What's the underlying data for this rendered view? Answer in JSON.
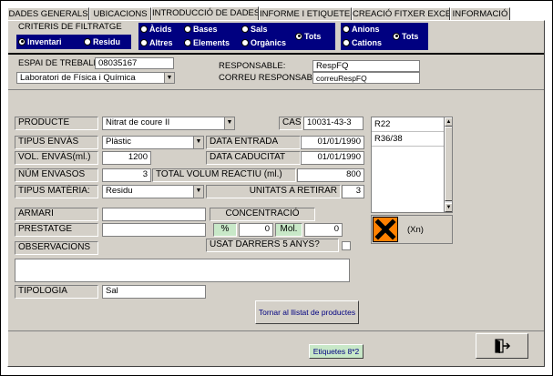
{
  "tabs": [
    {
      "label": "DADES GENERALS"
    },
    {
      "label": "UBICACIONS"
    },
    {
      "label": "INTRODUCCIÓ DE DADES"
    },
    {
      "label": "INFORME I ETIQUETES"
    },
    {
      "label": "CREACIÓ FITXER EXCEL"
    },
    {
      "label": "INFORMACIÓ"
    }
  ],
  "filter": {
    "title": "CRITERIS DE FILTRATGE",
    "inventari": "Inventari",
    "residu": "Residu",
    "acids": "Àcids",
    "bases": "Bases",
    "sals": "Sals",
    "altres": "Altres",
    "elements": "Elements",
    "organics": "Orgànics",
    "tots": "Tots",
    "anions": "Anions",
    "cations": "Cations",
    "tots2": "Tots"
  },
  "workspace": {
    "espai_label": "ESPAI DE TREBALL:",
    "espai_value": "08035167",
    "lab_value": "Laboratori de Física i Química",
    "responsable_label": "RESPONSABLE:",
    "responsable_value": "RespFQ",
    "correu_label": "CORREU RESPONSABLE:",
    "correu_value": "correuRespFQ"
  },
  "form": {
    "producte_label": "PRODUCTE",
    "producte_value": "Nitrat de coure II",
    "cas_label": "CAS",
    "cas_value": "10031-43-3",
    "tipus_envas_label": "TIPUS ENVÀS",
    "tipus_envas_value": "Plàstic",
    "data_entrada_label": "DATA ENTRADA",
    "data_entrada_value": "01/01/1990",
    "vol_envas_label": "VOL. ENVÀS(ml.)",
    "vol_envas_value": "1200",
    "data_caducitat_label": "DATA CADUCITAT",
    "data_caducitat_value": "01/01/1990",
    "num_envasos_label": "NÚM ENVASOS",
    "num_envasos_value": "3",
    "total_volum_label": "TOTAL VOLUM REACTIU (ml.)",
    "total_volum_value": "800",
    "tipus_materia_label": "TIPUS MATÈRIA:",
    "tipus_materia_value": "Residu",
    "unitats_label": "UNITATS A RETIRAR",
    "unitats_value": "3",
    "armari_label": "ARMARI",
    "armari_value": "",
    "concentracio_label": "CONCENTRACIÓ",
    "prestatge_label": "PRESTATGE",
    "prestatge_value": "",
    "percent_label": "%",
    "percent_value": "0",
    "mol_label": "Mol.",
    "mol_value": "0",
    "observacions_label": "OBSERVACIONS",
    "observacions_value": "",
    "usat_label": "USAT DARRERS 5 ANYS?",
    "tipologia_label": "TIPOLOGIA",
    "tipologia_value": "Sal"
  },
  "risks": {
    "items": [
      "R22",
      "R36/38"
    ],
    "hazard_code": "(Xn)"
  },
  "buttons": {
    "tornar": "Tornar al llistat de productes",
    "etiquetes": "Etiquetes 8*2"
  },
  "colors": {
    "navy": "#000080",
    "hazard_orange": "#ff8000",
    "green_label": "#c8e8c8"
  }
}
